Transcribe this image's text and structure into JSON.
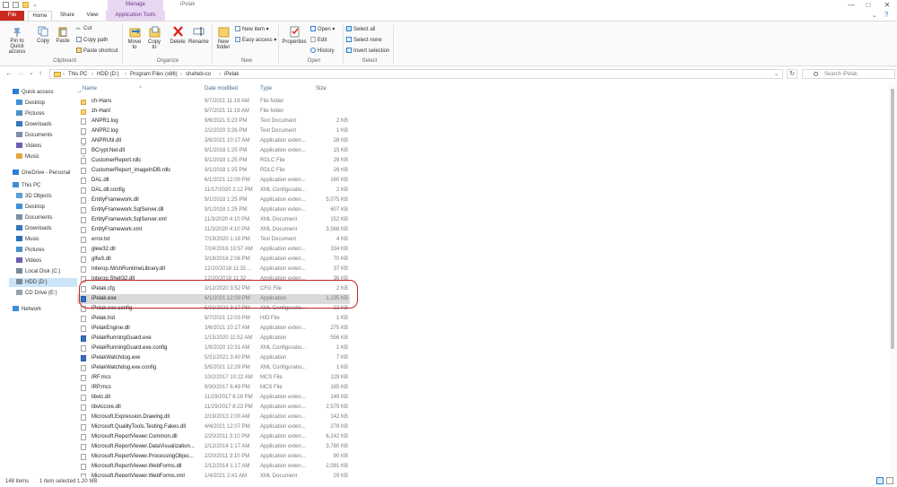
{
  "window": {
    "title": "iPelak",
    "manage_tab": "Manage",
    "min": "—",
    "max": "□",
    "close": "✕"
  },
  "ribbon_tabs": {
    "file": "File",
    "home": "Home",
    "share": "Share",
    "view": "View",
    "app_tools": "Application Tools"
  },
  "ribbon": {
    "pin": "Pin to Quick access",
    "copy": "Copy",
    "paste": "Paste",
    "cut": "Cut",
    "copy_path": "Copy path",
    "paste_shortcut": "Paste shortcut",
    "clipboard_group": "Clipboard",
    "move_to": "Move to",
    "copy_to": "Copy to",
    "delete": "Delete",
    "rename": "Rename",
    "organize_group": "Organize",
    "new_folder": "New folder",
    "new_item": "New item",
    "easy_access": "Easy access",
    "new_group": "New",
    "properties": "Properties",
    "open": "Open",
    "edit": "Edit",
    "history": "History",
    "open_group": "Open",
    "select_all": "Select all",
    "select_none": "Select none",
    "invert_selection": "Invert selection",
    "select_group": "Select"
  },
  "nav": {
    "back": "←",
    "forward": "→",
    "recent": "⌄",
    "up": "↑"
  },
  "address": {
    "crumbs": [
      "This PC",
      "HDD (D:)",
      "Program Files (x86)",
      "shaheb-co",
      "iPelak"
    ],
    "sep": "›"
  },
  "search": {
    "placeholder": "Search iPelak",
    "refresh": "↻"
  },
  "sidebar": {
    "items": [
      {
        "label": "Quick access",
        "icon": "star-icon",
        "color": "#2a7fd4"
      },
      {
        "label": "Desktop",
        "icon": "desktop-icon",
        "color": "#3a8fd9"
      },
      {
        "label": "Pictures",
        "icon": "pictures-icon",
        "color": "#4a90c8"
      },
      {
        "label": "Downloads",
        "icon": "downloads-icon",
        "color": "#2f76c2"
      },
      {
        "label": "Documents",
        "icon": "documents-icon",
        "color": "#7a8fa8"
      },
      {
        "label": "Videos",
        "icon": "videos-icon",
        "color": "#6b5fb5"
      },
      {
        "label": "Music",
        "icon": "music-icon",
        "color": "#e0a940"
      },
      {
        "label": "OneDrive - Personal",
        "icon": "onedrive-icon",
        "color": "#2a7fd4"
      },
      {
        "label": "This PC",
        "icon": "this-pc-icon",
        "color": "#3a8fd9"
      },
      {
        "label": "3D Objects",
        "icon": "3d-objects-icon",
        "color": "#57a0d8"
      },
      {
        "label": "Desktop",
        "icon": "desktop-icon",
        "color": "#3a8fd9"
      },
      {
        "label": "Documents",
        "icon": "documents-icon",
        "color": "#7a8fa8"
      },
      {
        "label": "Downloads",
        "icon": "downloads-icon",
        "color": "#2f76c2"
      },
      {
        "label": "Music",
        "icon": "music-icon",
        "color": "#2a6fb8"
      },
      {
        "label": "Pictures",
        "icon": "pictures-icon",
        "color": "#4a90c8"
      },
      {
        "label": "Videos",
        "icon": "videos-icon",
        "color": "#6b5fb5"
      },
      {
        "label": "Local Disk (C:)",
        "icon": "drive-icon",
        "color": "#7d8a96"
      },
      {
        "label": "HDD (D:)",
        "icon": "drive-icon",
        "color": "#7d8a96"
      },
      {
        "label": "CD Drive (E:)",
        "icon": "cd-drive-icon",
        "color": "#9aa3ab"
      },
      {
        "label": "Network",
        "icon": "network-icon",
        "color": "#3a8fd9"
      }
    ]
  },
  "columns": {
    "name": "Name",
    "date": "Date modified",
    "type": "Type",
    "size": "Size",
    "sort": "^"
  },
  "files": [
    {
      "name": "ch-Hans",
      "date": "9/7/2021 11:19 AM",
      "type": "File folder",
      "size": "",
      "icon": "folder-icon"
    },
    {
      "name": "zh-Hant",
      "date": "9/7/2021 11:19 AM",
      "type": "File folder",
      "size": "",
      "icon": "folder-icon"
    },
    {
      "name": "ANPR1.log",
      "date": "9/6/2021 5:23 PM",
      "type": "Text Document",
      "size": "2 KB",
      "icon": "file-icon"
    },
    {
      "name": "ANPR2.log",
      "date": "2/2/2020 3:26 PM",
      "type": "Text Document",
      "size": "1 KB",
      "icon": "file-icon"
    },
    {
      "name": "ANPRUtil.dll",
      "date": "3/6/2021 10:17 AM",
      "type": "Application exten...",
      "size": "28 KB",
      "icon": "file-icon"
    },
    {
      "name": "BCrypt.Net.dll",
      "date": "9/1/2018 1:25 PM",
      "type": "Application exten...",
      "size": "15 KB",
      "icon": "file-icon"
    },
    {
      "name": "CustomerReport.rdlc",
      "date": "9/1/2018 1:25 PM",
      "type": "RDLC File",
      "size": "29 KB",
      "icon": "file-icon"
    },
    {
      "name": "CustomerReport_imageInDB.rdlc",
      "date": "9/1/2018 1:25 PM",
      "type": "RDLC File",
      "size": "29 KB",
      "icon": "file-icon"
    },
    {
      "name": "DAL.dll",
      "date": "6/1/2021 12:00 PM",
      "type": "Application exten...",
      "size": "160 KB",
      "icon": "file-icon"
    },
    {
      "name": "DAL.dll.config",
      "date": "11/17/2020 2:12 PM",
      "type": "XML Configuratio...",
      "size": "2 KB",
      "icon": "file-icon"
    },
    {
      "name": "EntityFramework.dll",
      "date": "9/1/2018 1:25 PM",
      "type": "Application exten...",
      "size": "5,075 KB",
      "icon": "file-icon"
    },
    {
      "name": "EntityFramework.SqlServer.dll",
      "date": "9/1/2018 1:25 PM",
      "type": "Application exten...",
      "size": "607 KB",
      "icon": "file-icon"
    },
    {
      "name": "EntityFramework.SqlServer.xml",
      "date": "11/3/2020 4:10 PM",
      "type": "XML Document",
      "size": "152 KB",
      "icon": "file-icon"
    },
    {
      "name": "EntityFramework.xml",
      "date": "11/3/2020 4:10 PM",
      "type": "XML Document",
      "size": "3,568 KB",
      "icon": "file-icon"
    },
    {
      "name": "error.txt",
      "date": "7/19/2020 1:18 PM",
      "type": "Text Document",
      "size": "4 KB",
      "icon": "file-icon"
    },
    {
      "name": "glew32.dll",
      "date": "7/24/2016 10:57 AM",
      "type": "Application exten...",
      "size": "334 KB",
      "icon": "file-icon"
    },
    {
      "name": "glfw3.dll",
      "date": "3/18/2016 2:06 PM",
      "type": "Application exten...",
      "size": "70 KB",
      "icon": "file-icon"
    },
    {
      "name": "Interop.IWshRuntimeLibrary.dll",
      "date": "12/20/2018 11:32 ...",
      "type": "Application exten...",
      "size": "37 KB",
      "icon": "file-icon"
    },
    {
      "name": "Interop.Shell32.dll",
      "date": "12/20/2018 11:32 ...",
      "type": "Application exten...",
      "size": "36 KB",
      "icon": "file-icon"
    },
    {
      "name": "iPelak.cfg",
      "date": "3/12/2020 3:52 PM",
      "type": "CFG File",
      "size": "2 KB",
      "icon": "file-icon"
    },
    {
      "name": "iPelak.exe",
      "date": "6/1/2021 12:00 PM",
      "type": "Application",
      "size": "1,235 KB",
      "icon": "exe-icon",
      "selected": true
    },
    {
      "name": "iPelak.exe.config",
      "date": "5/31/2021 3:17 PM",
      "type": "XML Configuratio...",
      "size": "22 KB",
      "icon": "file-icon"
    },
    {
      "name": "iPelak.hid",
      "date": "9/7/2021 12:03 PM",
      "type": "HID File",
      "size": "1 KB",
      "icon": "file-icon"
    },
    {
      "name": "iPelakEngine.dll",
      "date": "3/6/2021 10:17 AM",
      "type": "Application exten...",
      "size": "275 KB",
      "icon": "file-icon"
    },
    {
      "name": "iPelakRunningGuard.exe",
      "date": "1/15/2020 11:52 AM",
      "type": "Application",
      "size": "556 KB",
      "icon": "exe-icon"
    },
    {
      "name": "iPelakRunningGuard.exe.config",
      "date": "1/9/2020 10:31 AM",
      "type": "XML Configuratio...",
      "size": "1 KB",
      "icon": "file-icon"
    },
    {
      "name": "iPelakWatchdog.exe",
      "date": "5/31/2021 3:40 PM",
      "type": "Application",
      "size": "7 KB",
      "icon": "exe-icon"
    },
    {
      "name": "iPelakWatchdog.exe.config",
      "date": "5/5/2021 12:29 PM",
      "type": "XML Configuratio...",
      "size": "1 KB",
      "icon": "file-icon"
    },
    {
      "name": "IRF.mcs",
      "date": "10/2/2017 10:22 AM",
      "type": "MCS File",
      "size": "129 KB",
      "icon": "file-icon"
    },
    {
      "name": "IRP.mcs",
      "date": "9/30/2017 6:49 PM",
      "type": "MCS File",
      "size": "185 KB",
      "icon": "file-icon"
    },
    {
      "name": "libvlc.dll",
      "date": "11/29/2017 8:18 PM",
      "type": "Application exten...",
      "size": "149 KB",
      "icon": "file-icon"
    },
    {
      "name": "libvlccore.dll",
      "date": "11/29/2017 8:23 PM",
      "type": "Application exten...",
      "size": "2,579 KB",
      "icon": "file-icon"
    },
    {
      "name": "Microsoft.Expression.Drawing.dll",
      "date": "2/19/2013 2:00 AM",
      "type": "Application exten...",
      "size": "142 KB",
      "icon": "file-icon"
    },
    {
      "name": "Microsoft.QualityTools.Testing.Fakes.dll",
      "date": "4/4/2021 12:07 PM",
      "type": "Application exten...",
      "size": "278 KB",
      "icon": "file-icon"
    },
    {
      "name": "Microsoft.ReportViewer.Common.dll",
      "date": "2/20/2011 3:10 PM",
      "type": "Application exten...",
      "size": "6,242 KB",
      "icon": "file-icon"
    },
    {
      "name": "Microsoft.ReportViewer.DataVisualization...",
      "date": "2/12/2014 1:17 AM",
      "type": "Application exten...",
      "size": "3,780 KB",
      "icon": "file-icon"
    },
    {
      "name": "Microsoft.ReportViewer.ProcessingObjec...",
      "date": "2/20/2011 3:10 PM",
      "type": "Application exten...",
      "size": "90 KB",
      "icon": "file-icon"
    },
    {
      "name": "Microsoft.ReportViewer.WebForms.dll",
      "date": "2/12/2014 1:17 AM",
      "type": "Application exten...",
      "size": "2,081 KB",
      "icon": "file-icon"
    },
    {
      "name": "Microsoft.ReportViewer.WebForms.xml",
      "date": "1/4/2021 2:41 AM",
      "type": "XML Document",
      "size": "29 KB",
      "icon": "file-icon"
    }
  ],
  "status": {
    "count": "148 items",
    "selected": "1 item selected  1.20 MB"
  },
  "colors": {
    "file_tab": "#c92a1e",
    "manage": "#e8d6f3",
    "highlight": "#c32323",
    "selection": "#cce4f7"
  }
}
